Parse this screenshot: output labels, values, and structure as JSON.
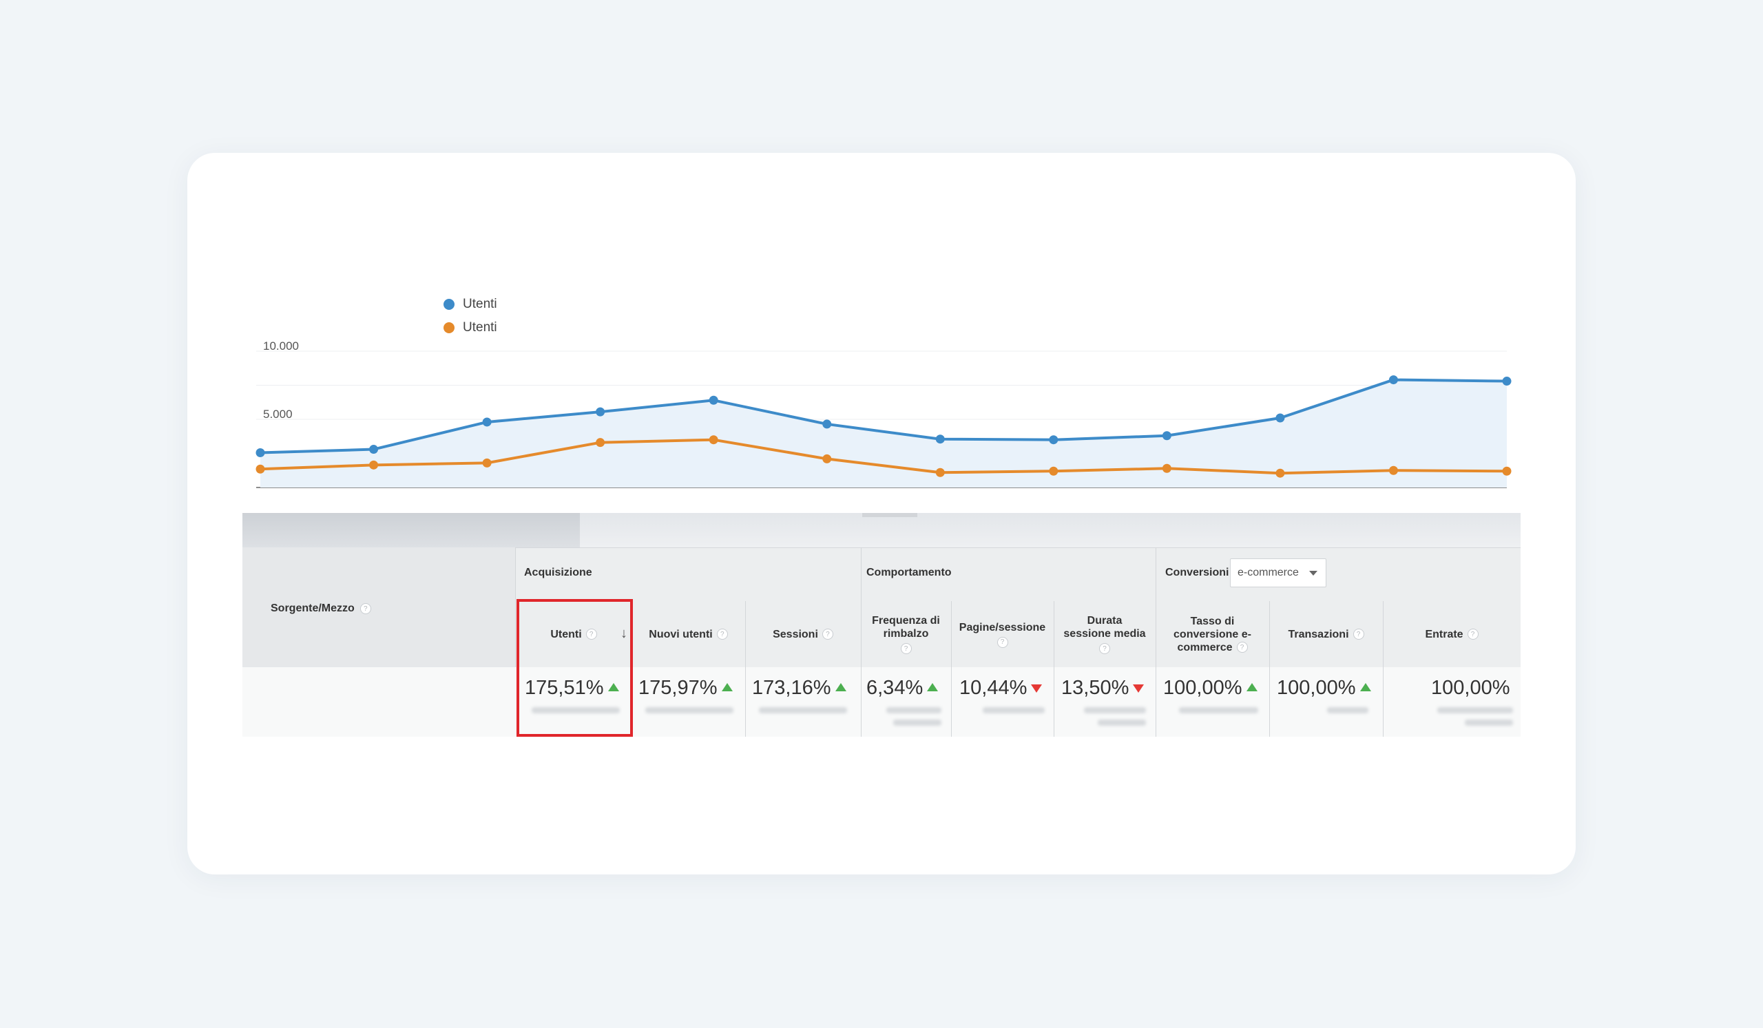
{
  "chart": {
    "legend": [
      {
        "label": "Utenti",
        "color": "#3d8bc9"
      },
      {
        "label": "Utenti",
        "color": "#e58a2b"
      }
    ],
    "y_ticks": [
      {
        "value": 10000,
        "label": "10.000"
      },
      {
        "value": 5000,
        "label": "5.000"
      }
    ]
  },
  "chart_data": {
    "type": "line",
    "title": "",
    "xlabel": "",
    "ylabel": "",
    "ylim": [
      0,
      10000
    ],
    "grid": true,
    "legend_position": "top-left",
    "series": [
      {
        "name": "Utenti",
        "color": "#3d8bc9",
        "values": [
          2550,
          2800,
          4800,
          5550,
          6400,
          4650,
          3550,
          3500,
          3800,
          5100,
          7900,
          7800
        ]
      },
      {
        "name": "Utenti",
        "color": "#e58a2b",
        "values": [
          1350,
          1650,
          1800,
          3300,
          3500,
          2100,
          1100,
          1200,
          1400,
          1050,
          1250,
          1200
        ]
      }
    ]
  },
  "table": {
    "source_header": "Sorgente/Mezzo",
    "groups": {
      "acquisition": "Acquisizione",
      "behavior": "Comportamento",
      "conversions": "Conversioni"
    },
    "conversions_dropdown": "e-commerce",
    "columns": [
      {
        "key": "users",
        "line1": "Utenti",
        "line2": "",
        "line3": "",
        "value": "175,51%",
        "trend": "up"
      },
      {
        "key": "new_users",
        "line1": "Nuovi utenti",
        "line2": "",
        "line3": "",
        "value": "175,97%",
        "trend": "up"
      },
      {
        "key": "sessions",
        "line1": "Sessioni",
        "line2": "",
        "line3": "",
        "value": "173,16%",
        "trend": "up"
      },
      {
        "key": "bounce_rate",
        "line1": "Frequenza di",
        "line2": "rimbalzo",
        "line3": "",
        "value": "6,34%",
        "trend": "up"
      },
      {
        "key": "pages_session",
        "line1": "Pagine/sessione",
        "line2": "",
        "line3": "",
        "value": "10,44%",
        "trend": "down"
      },
      {
        "key": "avg_duration",
        "line1": "Durata",
        "line2": "sessione media",
        "line3": "",
        "value": "13,50%",
        "trend": "down"
      },
      {
        "key": "conv_rate",
        "line1": "Tasso di",
        "line2": "conversione e-",
        "line3": "commerce",
        "value": "100,00%",
        "trend": "up"
      },
      {
        "key": "transactions",
        "line1": "Transazioni",
        "line2": "",
        "line3": "",
        "value": "100,00%",
        "trend": "up"
      },
      {
        "key": "revenue",
        "line1": "Entrate",
        "line2": "",
        "line3": "",
        "value": "100,00%",
        "trend": "none"
      }
    ]
  }
}
